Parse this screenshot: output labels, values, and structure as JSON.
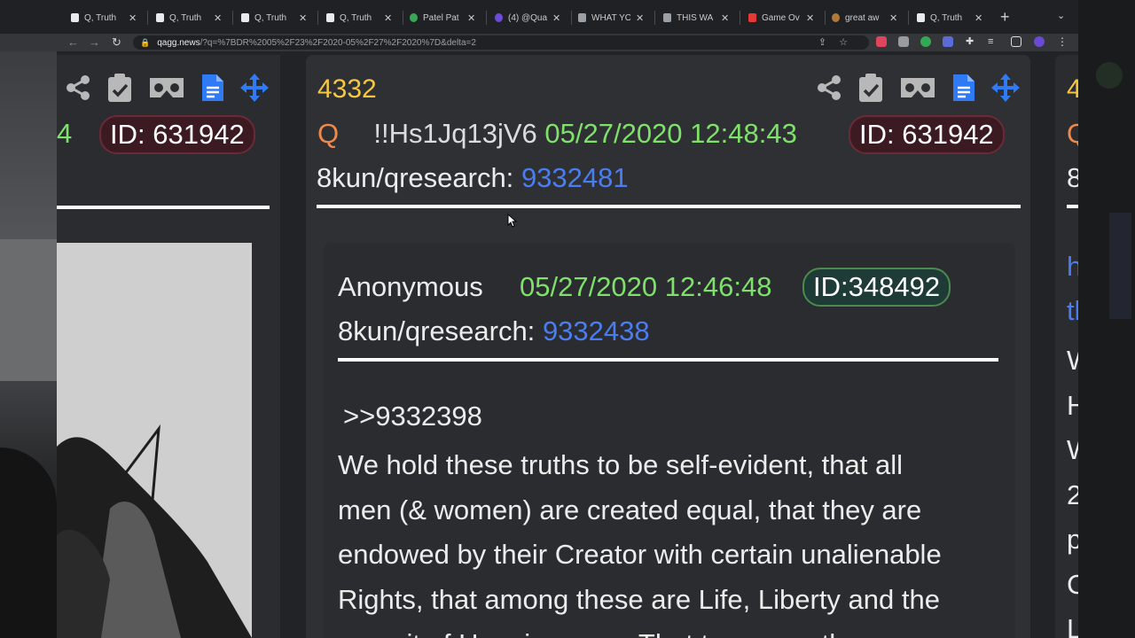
{
  "browser": {
    "tabs": [
      {
        "title": "Q, Truth",
        "active": true
      },
      {
        "title": "Q, Truth"
      },
      {
        "title": "Q, Truth"
      },
      {
        "title": "Q, Truth"
      },
      {
        "title": "Patel Pat"
      },
      {
        "title": "(4) @Qua"
      },
      {
        "title": "WHAT YO"
      },
      {
        "title": "THIS WA"
      },
      {
        "title": "Game Ov"
      },
      {
        "title": "great aw"
      },
      {
        "title": "Q, Truth"
      }
    ],
    "url_host": "qagg.news",
    "url_rest": "/?q=%7BDR%2005%2F23%2F2020-05%2F27%2F2020%7D&delta=2"
  },
  "left_card": {
    "peek_num": "4",
    "id_label": "ID: 631942"
  },
  "main_card": {
    "post_number": "4332",
    "q_label": "Q",
    "tripcode": "!!Hs1Jq13jV6",
    "datetime": "05/27/2020 12:48:43",
    "id_label": "ID: 631942",
    "board_label": "8kun/qresearch:",
    "board_post": "9332481",
    "reply": {
      "author": "Anonymous",
      "datetime": "05/27/2020 12:46:48",
      "id_label": "ID:348492",
      "board_label": "8kun/qresearch:",
      "board_post": "9332438",
      "reference": ">>9332398",
      "body_lines": [
        "We hold these truths to be self-evident, that all",
        "men (& women) are created equal, that they are",
        "endowed by their Creator with certain unalienable",
        "Rights, that among these are Life, Liberty and the",
        "pursuit of Happiness. — That to secure these"
      ]
    }
  },
  "right_card": {
    "peek_lines": [
      "4",
      "Q",
      "8",
      "",
      "h",
      "tl",
      "W",
      "H",
      "W",
      "2",
      "p",
      "C",
      "L"
    ]
  },
  "colors": {
    "post_number": "#f5c842",
    "q_label": "#f0894a",
    "datetime": "#7ee16a",
    "link": "#4a7ef0",
    "action_icons": "#b8b8b8",
    "blue_icons": "#2f7bf5"
  },
  "icons": [
    "share-icon",
    "clipboard-check-icon",
    "vr-headset-icon",
    "document-icon",
    "move-arrows-icon"
  ]
}
